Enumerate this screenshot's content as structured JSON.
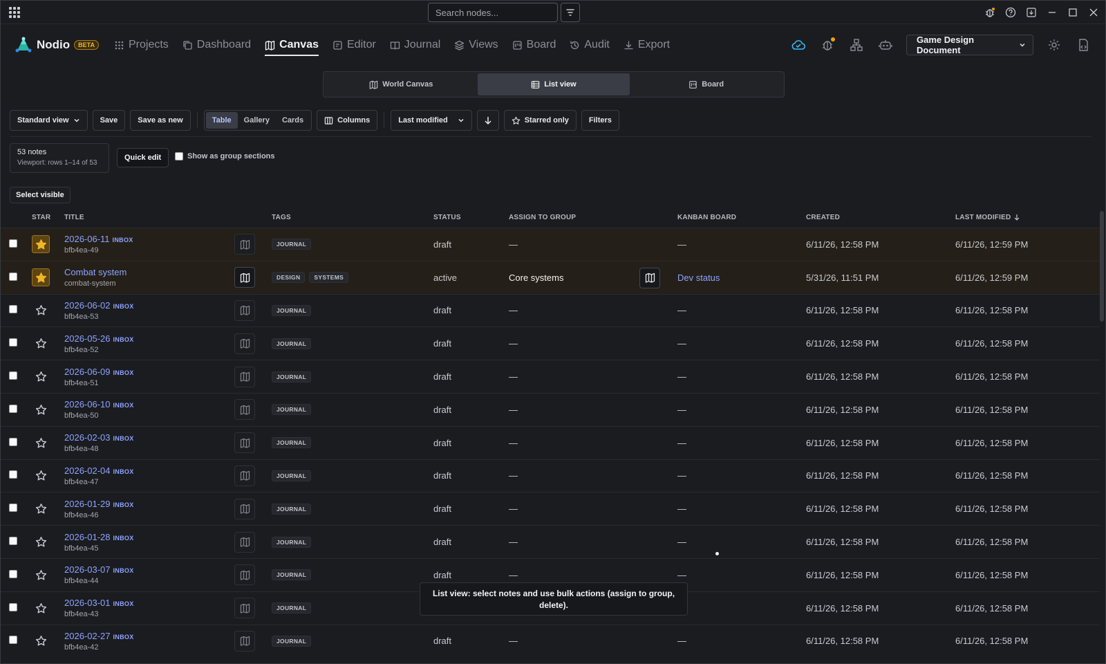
{
  "titlebar": {
    "search_placeholder": "Search nodes...",
    "icons": [
      "apps-grid-icon",
      "filter-icon",
      "bug-icon",
      "help-icon",
      "download-icon",
      "minimize-icon",
      "maximize-icon",
      "close-icon"
    ]
  },
  "brand": {
    "name": "Nodio",
    "badge": "BETA"
  },
  "nav": {
    "tabs": [
      {
        "label": "Projects",
        "icon": "grid-icon"
      },
      {
        "label": "Dashboard",
        "icon": "copy-icon"
      },
      {
        "label": "Canvas",
        "icon": "map-icon",
        "active": true
      },
      {
        "label": "Editor",
        "icon": "edit-icon"
      },
      {
        "label": "Journal",
        "icon": "book-icon"
      },
      {
        "label": "Views",
        "icon": "layers-icon"
      },
      {
        "label": "Board",
        "icon": "board-icon"
      },
      {
        "label": "Audit",
        "icon": "history-icon"
      },
      {
        "label": "Export",
        "icon": "export-icon"
      }
    ],
    "document": "Game Design Document"
  },
  "view_switch": {
    "world_canvas": "World Canvas",
    "list_view": "List view",
    "board": "Board"
  },
  "toolbar": {
    "standard_view": "Standard view",
    "save": "Save",
    "save_as_new": "Save as new",
    "table": "Table",
    "gallery": "Gallery",
    "cards": "Cards",
    "columns": "Columns",
    "sort": "Last modified",
    "starred_only": "Starred only",
    "filters": "Filters"
  },
  "summary": {
    "count": "53 notes",
    "viewport": "Viewport: rows 1–14 of 53"
  },
  "quick_edit": "Quick edit",
  "group_sections": "Show as group sections",
  "select_visible": "Select visible",
  "columns": {
    "star": "STAR",
    "title": "TITLE",
    "tags": "TAGS",
    "status": "STATUS",
    "group": "ASSIGN TO GROUP",
    "kanban": "KANBAN BOARD",
    "created": "CREATED",
    "modified": "LAST MODIFIED"
  },
  "rows": [
    {
      "starred": true,
      "title": "2026-06-11",
      "inbox": "INBOX",
      "slug": "bfb4ea-49",
      "tags": [
        "JOURNAL"
      ],
      "status": "draft",
      "group": "—",
      "kanban": "—",
      "created": "6/11/26, 12:58 PM",
      "modified": "6/11/26, 12:59 PM"
    },
    {
      "starred": true,
      "title": "Combat system",
      "inbox": "",
      "slug": "combat-system",
      "tags": [
        "DESIGN",
        "SYSTEMS"
      ],
      "status": "active",
      "group": "Core systems",
      "kanban": "Dev status",
      "created": "5/31/26, 11:51 PM",
      "modified": "6/11/26, 12:59 PM"
    },
    {
      "starred": false,
      "title": "2026-06-02",
      "inbox": "INBOX",
      "slug": "bfb4ea-53",
      "tags": [
        "JOURNAL"
      ],
      "status": "draft",
      "group": "—",
      "kanban": "—",
      "created": "6/11/26, 12:58 PM",
      "modified": "6/11/26, 12:58 PM"
    },
    {
      "starred": false,
      "title": "2026-05-26",
      "inbox": "INBOX",
      "slug": "bfb4ea-52",
      "tags": [
        "JOURNAL"
      ],
      "status": "draft",
      "group": "—",
      "kanban": "—",
      "created": "6/11/26, 12:58 PM",
      "modified": "6/11/26, 12:58 PM"
    },
    {
      "starred": false,
      "title": "2026-06-09",
      "inbox": "INBOX",
      "slug": "bfb4ea-51",
      "tags": [
        "JOURNAL"
      ],
      "status": "draft",
      "group": "—",
      "kanban": "—",
      "created": "6/11/26, 12:58 PM",
      "modified": "6/11/26, 12:58 PM"
    },
    {
      "starred": false,
      "title": "2026-06-10",
      "inbox": "INBOX",
      "slug": "bfb4ea-50",
      "tags": [
        "JOURNAL"
      ],
      "status": "draft",
      "group": "—",
      "kanban": "—",
      "created": "6/11/26, 12:58 PM",
      "modified": "6/11/26, 12:58 PM"
    },
    {
      "starred": false,
      "title": "2026-02-03",
      "inbox": "INBOX",
      "slug": "bfb4ea-48",
      "tags": [
        "JOURNAL"
      ],
      "status": "draft",
      "group": "—",
      "kanban": "—",
      "created": "6/11/26, 12:58 PM",
      "modified": "6/11/26, 12:58 PM"
    },
    {
      "starred": false,
      "title": "2026-02-04",
      "inbox": "INBOX",
      "slug": "bfb4ea-47",
      "tags": [
        "JOURNAL"
      ],
      "status": "draft",
      "group": "—",
      "kanban": "—",
      "created": "6/11/26, 12:58 PM",
      "modified": "6/11/26, 12:58 PM"
    },
    {
      "starred": false,
      "title": "2026-01-29",
      "inbox": "INBOX",
      "slug": "bfb4ea-46",
      "tags": [
        "JOURNAL"
      ],
      "status": "draft",
      "group": "—",
      "kanban": "—",
      "created": "6/11/26, 12:58 PM",
      "modified": "6/11/26, 12:58 PM"
    },
    {
      "starred": false,
      "title": "2026-01-28",
      "inbox": "INBOX",
      "slug": "bfb4ea-45",
      "tags": [
        "JOURNAL"
      ],
      "status": "draft",
      "group": "—",
      "kanban": "—",
      "created": "6/11/26, 12:58 PM",
      "modified": "6/11/26, 12:58 PM"
    },
    {
      "starred": false,
      "title": "2026-03-07",
      "inbox": "INBOX",
      "slug": "bfb4ea-44",
      "tags": [
        "JOURNAL"
      ],
      "status": "draft",
      "group": "—",
      "kanban": "—",
      "created": "6/11/26, 12:58 PM",
      "modified": "6/11/26, 12:58 PM"
    },
    {
      "starred": false,
      "title": "2026-03-01",
      "inbox": "INBOX",
      "slug": "bfb4ea-43",
      "tags": [
        "JOURNAL"
      ],
      "status": "",
      "group": "",
      "kanban": "",
      "created": "6/11/26, 12:58 PM",
      "modified": "6/11/26, 12:58 PM"
    },
    {
      "starred": false,
      "title": "2026-02-27",
      "inbox": "INBOX",
      "slug": "bfb4ea-42",
      "tags": [
        "JOURNAL"
      ],
      "status": "draft",
      "group": "—",
      "kanban": "—",
      "created": "6/11/26, 12:58 PM",
      "modified": "6/11/26, 12:58 PM"
    }
  ],
  "tooltip": "List view: select notes and use bulk actions (assign to group, delete).",
  "colors": {
    "accent_link": "#8ea4ff",
    "star_gold": "#f0b429",
    "background": "#1b1c20"
  }
}
